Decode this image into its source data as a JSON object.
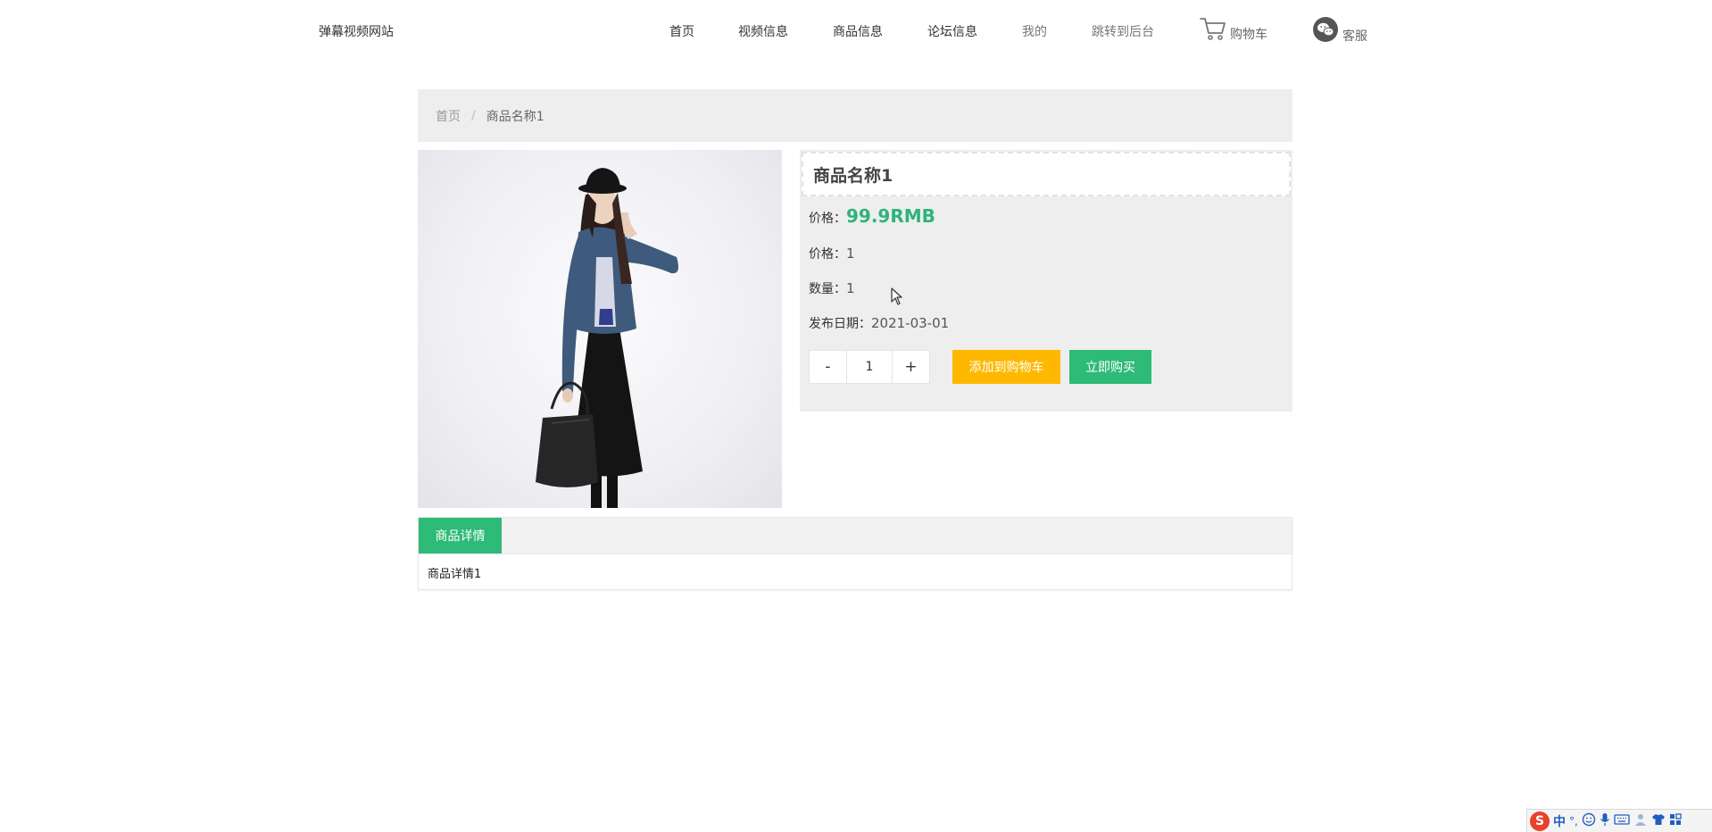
{
  "header": {
    "site_title": "弹幕视频网站",
    "nav": {
      "home": "首页",
      "video_info": "视频信息",
      "product_info": "商品信息",
      "forum_info": "论坛信息",
      "mine": "我的",
      "admin": "跳转到后台",
      "cart": "购物车",
      "service": "客服"
    }
  },
  "breadcrumb": {
    "home": "首页",
    "separator": "/",
    "current": "商品名称1"
  },
  "product": {
    "name": "商品名称1",
    "price_label": "价格：",
    "price_value": "99.9RMB",
    "price2_label": "价格：",
    "price2_value": "1",
    "quantity_label": "数量：",
    "quantity_value": "1",
    "date_label": "发布日期：",
    "date_value": "2021-03-01",
    "qty_minus": "-",
    "qty_input": "1",
    "qty_plus": "+",
    "add_to_cart": "添加到购物车",
    "buy_now": "立即购买"
  },
  "detail": {
    "tab_label": "商品详情",
    "content": "商品详情1"
  },
  "ime": {
    "logo": "S",
    "lang": "中",
    "punct": "°,"
  },
  "colors": {
    "accent_green": "#2eba77",
    "price_green": "#2fb37a",
    "cart_yellow": "#ffb800",
    "panel_gray": "#eeeeee"
  },
  "icons": [
    "cart-icon",
    "wechat-icon",
    "cursor-icon",
    "smiley-icon",
    "mic-icon",
    "keyboard-icon",
    "person-icon",
    "shirt-icon",
    "grid-icon"
  ]
}
